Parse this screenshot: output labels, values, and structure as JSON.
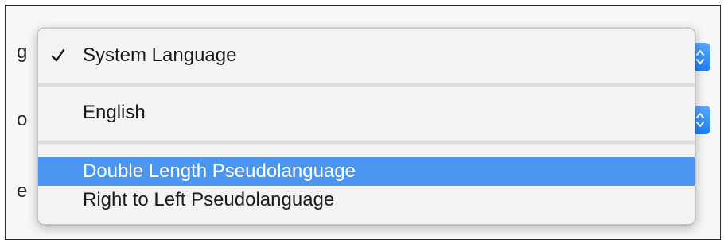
{
  "background": {
    "label_1": "g",
    "label_2": "o",
    "label_3": "e"
  },
  "menu": {
    "items": [
      {
        "label": "System Language",
        "checked": true,
        "selected": false
      },
      {
        "label": "English",
        "checked": false,
        "selected": false
      },
      {
        "label": "Double Length Pseudolanguage",
        "checked": false,
        "selected": true
      },
      {
        "label": "Right to Left Pseudolanguage",
        "checked": false,
        "selected": false
      }
    ]
  },
  "colors": {
    "highlight": "#4a96f0",
    "stepper_top": "#5aa9ff",
    "stepper_bottom": "#1f7ef5"
  },
  "icons": {
    "checkmark": "checkmark-icon",
    "stepper": "chevron-up-down-icon"
  }
}
